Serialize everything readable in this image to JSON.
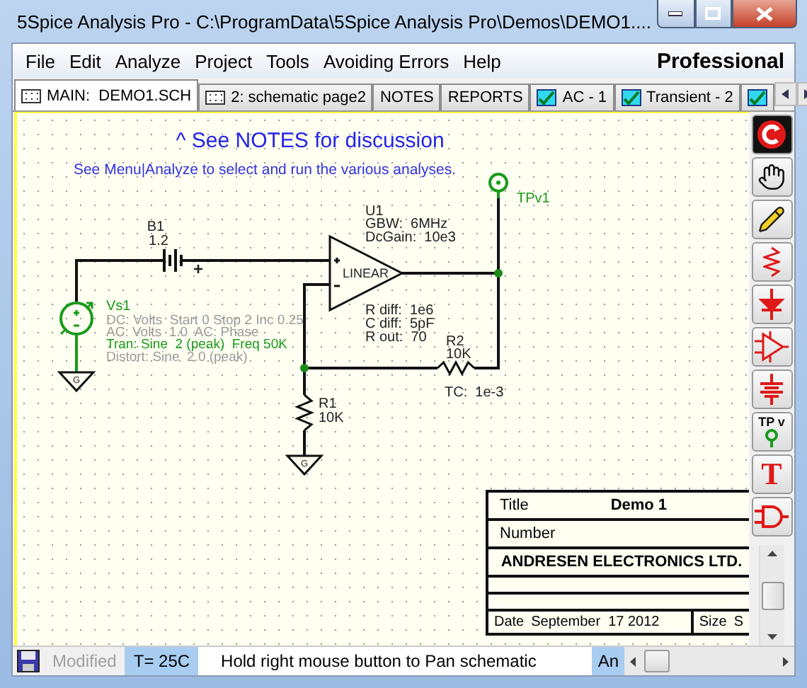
{
  "window": {
    "title": "5Spice Analysis Pro - C:\\ProgramData\\5Spice Analysis Pro\\Demos\\DEMO1...."
  },
  "menu": [
    "File",
    "Edit",
    "Analyze",
    "Project",
    "Tools",
    "Avoiding Errors",
    "Help"
  ],
  "edition": "Professional",
  "tabs": [
    {
      "label": "MAIN:  DEMO1.SCH",
      "kind": "schematic",
      "selected": true
    },
    {
      "label": "2: schematic page2",
      "kind": "schematic",
      "selected": false
    },
    {
      "label": "NOTES",
      "kind": "text",
      "selected": false
    },
    {
      "label": "REPORTS",
      "kind": "text",
      "selected": false
    },
    {
      "label": "AC - 1",
      "kind": "chart",
      "selected": false
    },
    {
      "label": "Transient - 2",
      "kind": "chart",
      "selected": false
    },
    {
      "kind": "chart",
      "selected": false
    }
  ],
  "schematic": {
    "heading": "^ See NOTES for discussion",
    "note": "See Menu|Analyze to select and run the various analyses.",
    "battery": {
      "name": "B1",
      "value": "1.2",
      "polarity": "+"
    },
    "source": {
      "name": "Vs1",
      "settings": [
        {
          "text": "DC: Volts  Start 0 Stop 2 Inc 0.25",
          "active": false
        },
        {
          "text": "AC: Volts  1.0  AC: Phase",
          "active": false
        },
        {
          "text": "Tran: Sine  2 (peak)  Freq 50K",
          "active": true
        },
        {
          "text": "Distort: Sine  2.0 (peak)",
          "active": false
        }
      ]
    },
    "opamp": {
      "name": "U1",
      "model": "LINEAR",
      "params": [
        "GBW:  6MHz",
        "DcGain:  10e3"
      ],
      "details": [
        "R diff:  1e6",
        "C diff:  5pF",
        "R out:  70"
      ]
    },
    "resistors": [
      {
        "name": "R2",
        "value": "10K",
        "note": "TC:  1e-3"
      },
      {
        "name": "R1",
        "value": "10K"
      }
    ],
    "probe": {
      "name": "TPv1"
    },
    "grounds": [
      "G",
      "G"
    ]
  },
  "title_block": {
    "title_label": "Title",
    "title": "Demo 1",
    "number_label": "Number",
    "company": "ANDRESEN ELECTRONICS LTD.",
    "date_label": "Date",
    "date": "September  17 2012",
    "size_label": "Size",
    "size": "S"
  },
  "tools": [
    {
      "kind": "refresh"
    },
    {
      "kind": "hand"
    },
    {
      "kind": "pencil"
    },
    {
      "kind": "resistor"
    },
    {
      "kind": "diode"
    },
    {
      "kind": "opamp"
    },
    {
      "kind": "capacitor"
    },
    {
      "kind": "probe",
      "label": "TP v"
    },
    {
      "kind": "text",
      "label": "T"
    },
    {
      "kind": "gate"
    }
  ],
  "status": {
    "modified": {
      "label": "Modified",
      "active": false
    },
    "temperature": "T= 25C",
    "hint": "Hold right mouse button to Pan schematic",
    "analysis": "An"
  }
}
